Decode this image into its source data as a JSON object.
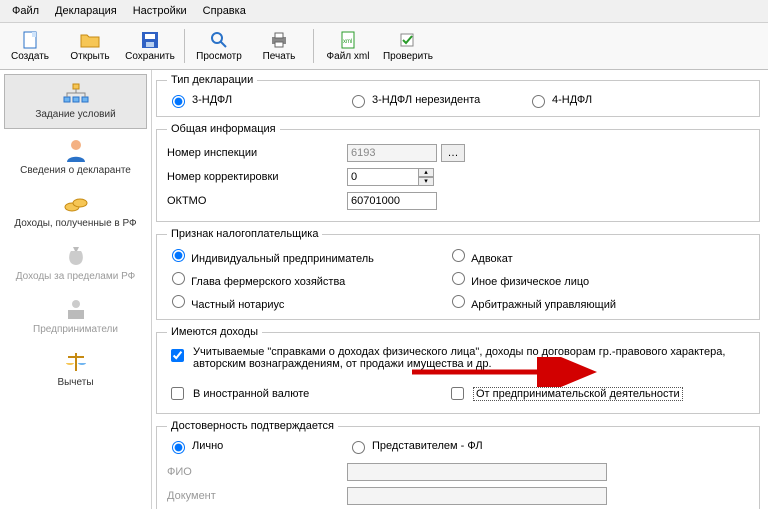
{
  "menu": {
    "file": "Файл",
    "decl": "Декларация",
    "settings": "Настройки",
    "help": "Справка"
  },
  "toolbar": {
    "create": "Создать",
    "open": "Открыть",
    "save": "Сохранить",
    "preview": "Просмотр",
    "print": "Печать",
    "xml": "Файл xml",
    "check": "Проверить"
  },
  "sidebar": {
    "items": [
      {
        "label": "Задание условий"
      },
      {
        "label": "Сведения о декларанте"
      },
      {
        "label": "Доходы, полученные в РФ"
      },
      {
        "label": "Доходы за пределами РФ"
      },
      {
        "label": "Предприниматели"
      },
      {
        "label": "Вычеты"
      }
    ]
  },
  "type": {
    "legend": "Тип декларации",
    "opt1": "3-НДФЛ",
    "opt2": "3-НДФЛ нерезидента",
    "opt3": "4-НДФЛ"
  },
  "general": {
    "legend": "Общая информация",
    "insp_lbl": "Номер инспекции",
    "insp_val": "6193",
    "corr_lbl": "Номер корректировки",
    "corr_val": "0",
    "oktmo_lbl": "ОКТМО",
    "oktmo_val": "60701000"
  },
  "taxpayer": {
    "legend": "Признак налогоплательщика",
    "opt1": "Индивидуальный предприниматель",
    "opt2": "Адвокат",
    "opt3": "Глава фермерского хозяйства",
    "opt4": "Иное физическое лицо",
    "opt5": "Частный нотариус",
    "opt6": "Арбитражный управляющий"
  },
  "income": {
    "legend": "Имеются доходы",
    "chk1": "Учитываемые \"справками о доходах физического лица\", доходы по договорам гр.-правового характера, авторским вознаграждениям, от продажи имущества и др.",
    "chk2": "В иностранной валюте",
    "chk3": "От предпринимательской деятельности"
  },
  "auth": {
    "legend": "Достоверность подтверждается",
    "opt1": "Лично",
    "opt2": "Представителем - ФЛ",
    "fio_lbl": "ФИО",
    "doc_lbl": "Документ"
  }
}
